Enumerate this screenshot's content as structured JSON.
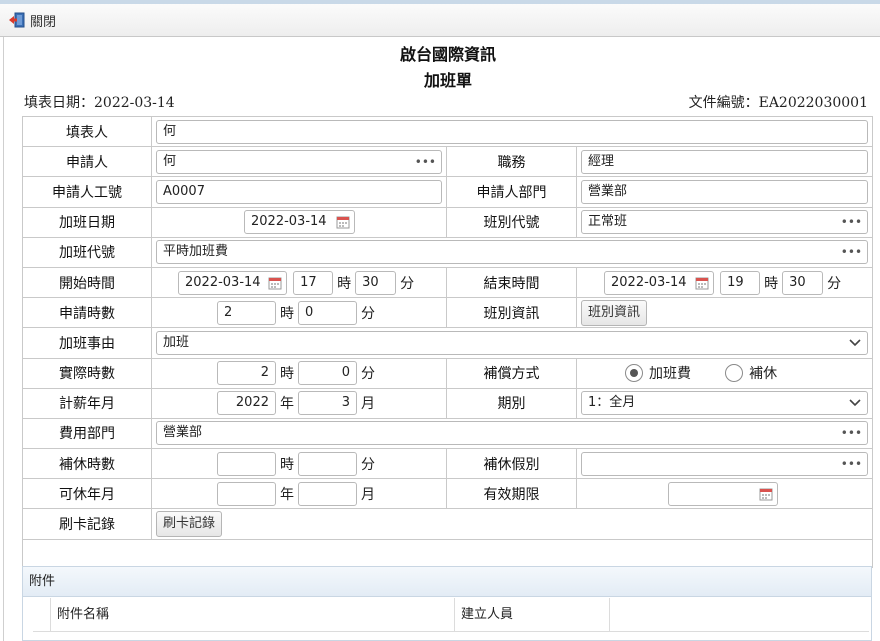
{
  "toolbar": {
    "close_label": "關閉"
  },
  "header": {
    "company": "啟台國際資訊",
    "form_title": "加班單",
    "fill_date": "填表日期：2022-03-14",
    "doc_no": "文件編號：EA2022030001"
  },
  "labels": {
    "filler": "填表人",
    "applicant": "申請人",
    "position": "職務",
    "emp_no": "申請人工號",
    "dept": "申請人部門",
    "ot_date": "加班日期",
    "shift_code": "班別代號",
    "ot_code": "加班代號",
    "start_time": "開始時間",
    "end_time": "結束時間",
    "apply_hours": "申請時數",
    "shift_info": "班別資訊",
    "reason": "加班事由",
    "actual_hours": "實際時數",
    "comp_method": "補償方式",
    "pay_month": "計薪年月",
    "period": "期別",
    "cost_dept": "費用部門",
    "comp_hours": "補休時數",
    "comp_leave_type": "補休假別",
    "avail_month": "可休年月",
    "valid_until": "有效期限",
    "card_record": "刷卡記錄"
  },
  "units": {
    "hour": "時",
    "minute": "分",
    "year": "年",
    "month": "月"
  },
  "values": {
    "filler": "何",
    "applicant": "何",
    "position": "經理",
    "emp_no": "A0007",
    "dept": "營業部",
    "ot_date": "2022-03-14",
    "shift_code": "正常班",
    "ot_code": "平時加班費",
    "start_date": "2022-03-14",
    "start_hour": "17",
    "start_min": "30",
    "end_date": "2022-03-14",
    "end_hour": "19",
    "end_min": "30",
    "apply_hour": "2",
    "apply_min": "0",
    "reason": "加班",
    "actual_hour": "2",
    "actual_min": "0",
    "pay_year": "2022",
    "pay_month": "3",
    "period": "1：全月",
    "cost_dept": "營業部",
    "comp_hour": "",
    "comp_min": "",
    "comp_leave_type": "",
    "avail_year": "",
    "avail_month": "",
    "valid_until": ""
  },
  "buttons": {
    "shift_info": "班別資訊",
    "card_record": "刷卡記錄"
  },
  "comp_options": [
    {
      "label": "加班費",
      "selected": true
    },
    {
      "label": "補休",
      "selected": false
    }
  ],
  "attachments": {
    "title": "附件",
    "columns": [
      "附件名稱",
      "建立人員"
    ]
  }
}
